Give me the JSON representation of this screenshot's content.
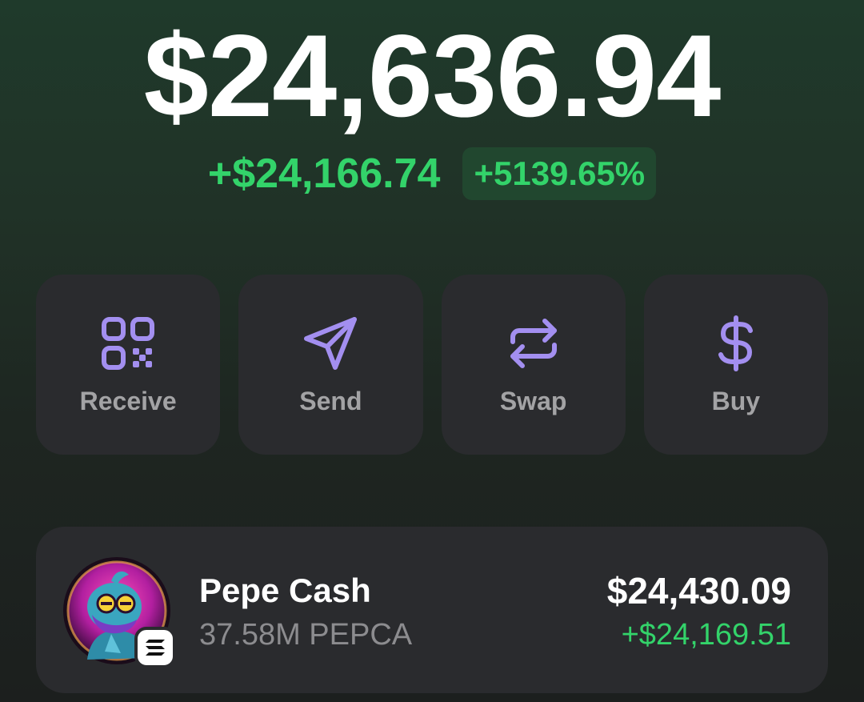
{
  "portfolio": {
    "balance": "$24,636.94",
    "change_amount": "+$24,166.74",
    "change_percent": "+5139.65%"
  },
  "colors": {
    "accent": "#a38ff0",
    "positive": "#33d36a",
    "card": "#2a2b2e",
    "muted_label": "#a3a3a5"
  },
  "actions": [
    {
      "label": "Receive",
      "icon": "qr-code-icon"
    },
    {
      "label": "Send",
      "icon": "send-icon"
    },
    {
      "label": "Swap",
      "icon": "swap-arrows-icon"
    },
    {
      "label": "Buy",
      "icon": "dollar-icon"
    }
  ],
  "tokens": [
    {
      "name": "Pepe Cash",
      "quantity": "37.58M PEPCA",
      "value": "$24,430.09",
      "change": "+$24,169.51",
      "avatar_icon": "pepe-avatar",
      "chain_icon": "solana-chain-icon"
    }
  ]
}
